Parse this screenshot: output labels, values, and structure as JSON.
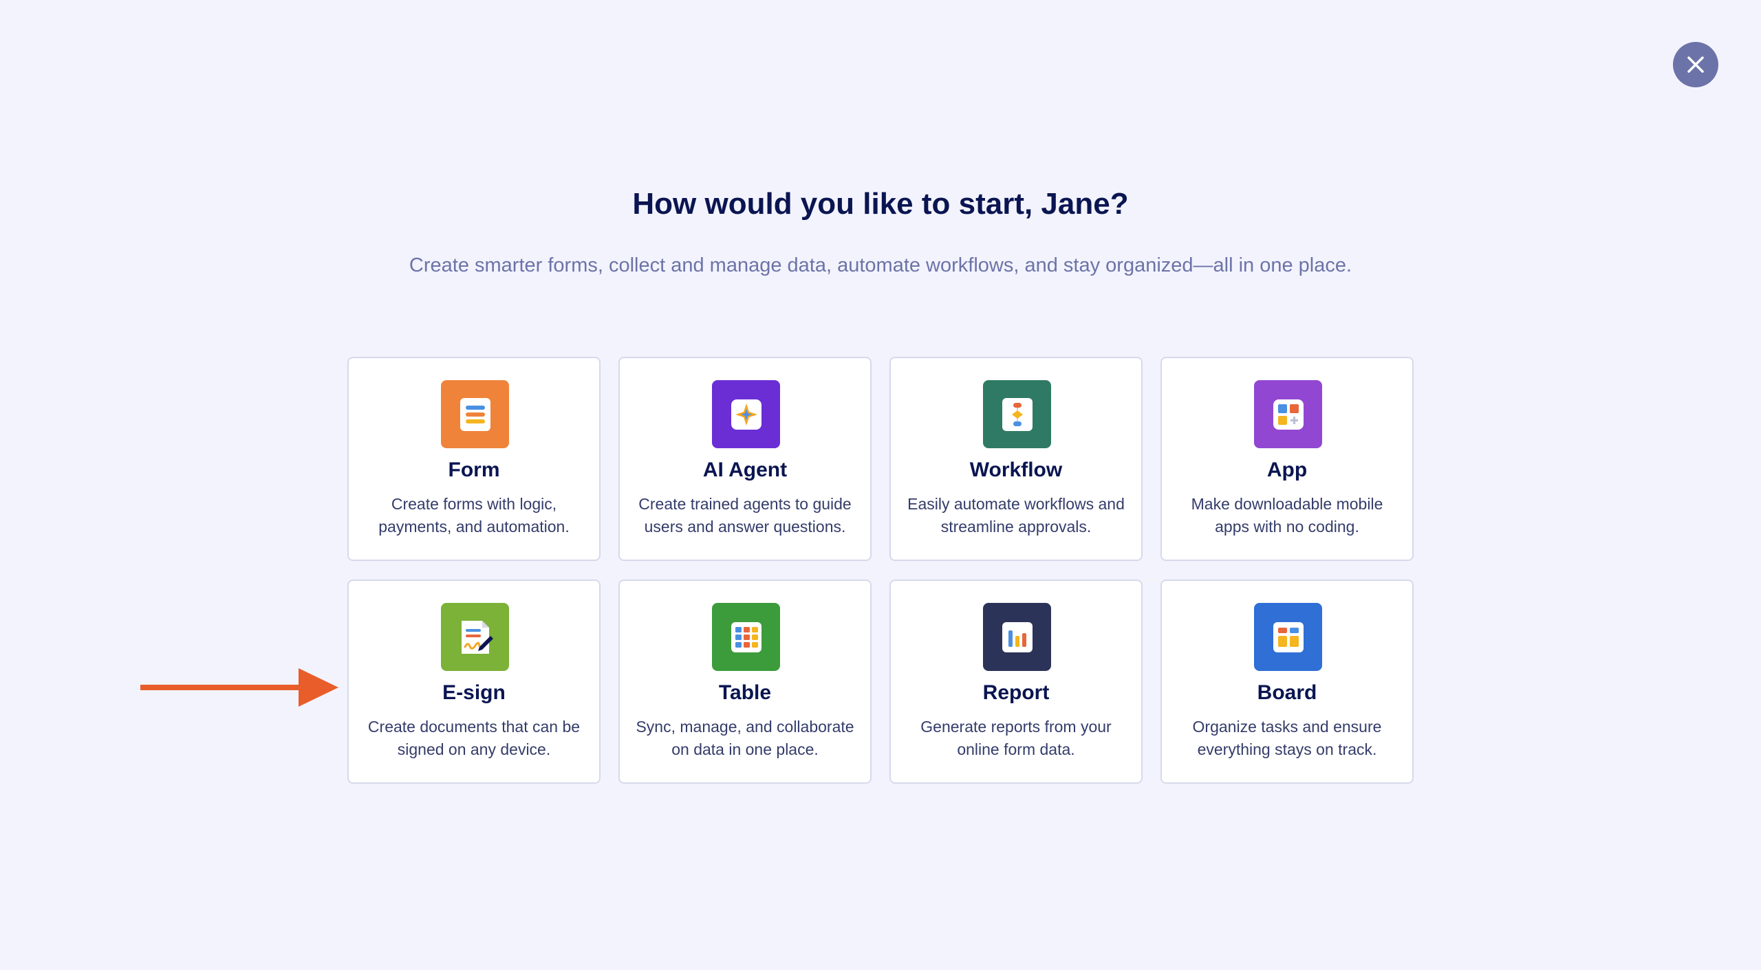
{
  "page": {
    "heading": "How would you like to start, Jane?",
    "subheading": "Create smarter forms, collect and manage data, automate workflows, and stay organized—all in one place."
  },
  "close": {
    "icon": "close-icon"
  },
  "cards": [
    {
      "title": "Form",
      "desc": "Create forms with logic, payments, and automation.",
      "icon": "form-icon",
      "color": "#f0833a"
    },
    {
      "title": "AI Agent",
      "desc": "Create trained agents to guide users and answer questions.",
      "icon": "ai-agent-icon",
      "color": "#6b2ed5"
    },
    {
      "title": "Workflow",
      "desc": "Easily automate workflows and streamline approvals.",
      "icon": "workflow-icon",
      "color": "#2f7a64"
    },
    {
      "title": "App",
      "desc": "Make downloadable mobile apps with no coding.",
      "icon": "app-icon",
      "color": "#9247d2"
    },
    {
      "title": "E-sign",
      "desc": "Create documents that can be signed on any device.",
      "icon": "esign-icon",
      "color": "#7bb237"
    },
    {
      "title": "Table",
      "desc": "Sync, manage, and collaborate on data in one place.",
      "icon": "table-icon",
      "color": "#3c9c3c"
    },
    {
      "title": "Report",
      "desc": "Generate reports from your online form data.",
      "icon": "report-icon",
      "color": "#2b3358"
    },
    {
      "title": "Board",
      "desc": "Organize tasks and ensure everything stays on track.",
      "icon": "board-icon",
      "color": "#2f6fd6"
    }
  ],
  "annotation": {
    "icon": "arrow-right-icon",
    "color": "#e85d2a"
  }
}
